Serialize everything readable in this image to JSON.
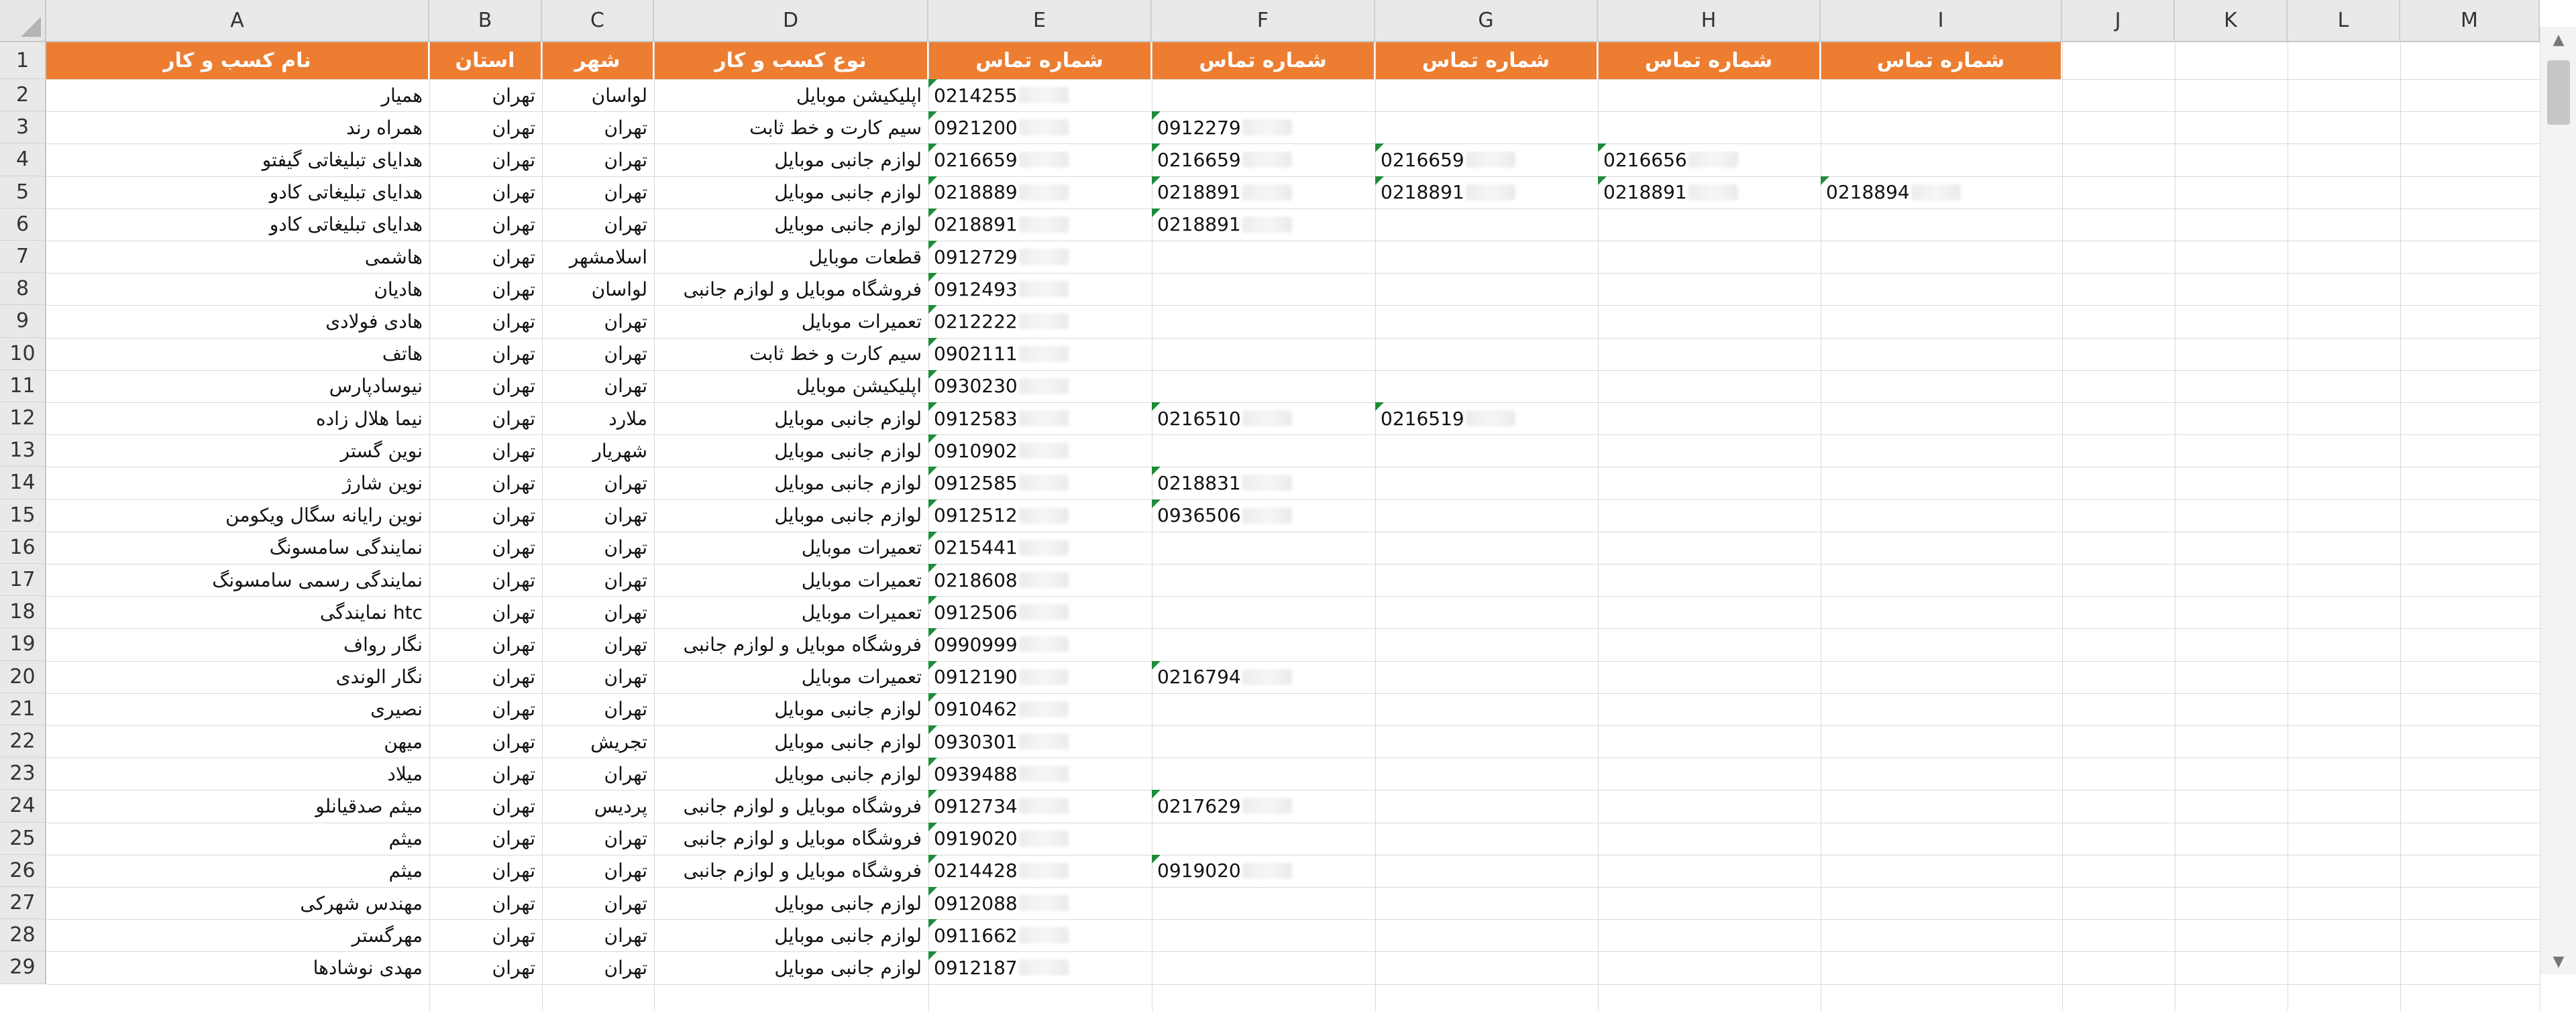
{
  "columns": [
    "A",
    "B",
    "C",
    "D",
    "E",
    "F",
    "G",
    "H",
    "I",
    "J",
    "K",
    "L",
    "M"
  ],
  "header_color": "#ed7d31",
  "flag_color": "#1e8c3a",
  "headers": [
    "نام کسب و کار",
    "استان",
    "شهر",
    "نوع کسب و کار",
    "شماره تماس",
    "شماره تماس",
    "شماره تماس",
    "شماره تماس",
    "شماره تماس"
  ],
  "rows": [
    {
      "num": "2",
      "name": "همیار",
      "province": "تهران",
      "city": "لواسان",
      "type": "اپلیکیشن موبایل",
      "phones": [
        "0214255",
        "",
        "",
        "",
        ""
      ]
    },
    {
      "num": "3",
      "name": "همراه رند",
      "province": "تهران",
      "city": "تهران",
      "type": "سیم کارت و خط ثابت",
      "phones": [
        "0921200",
        "0912279",
        "",
        "",
        ""
      ]
    },
    {
      "num": "4",
      "name": "هدایای تبلیغاتی گیفتو",
      "province": "تهران",
      "city": "تهران",
      "type": "لوازم جانبی موبایل",
      "phones": [
        "0216659",
        "0216659",
        "0216659",
        "0216656",
        ""
      ]
    },
    {
      "num": "5",
      "name": "هدایای تبلیغاتی کادو",
      "province": "تهران",
      "city": "تهران",
      "type": "لوازم جانبی موبایل",
      "phones": [
        "0218889",
        "0218891",
        "0218891",
        "0218891",
        "0218894"
      ]
    },
    {
      "num": "6",
      "name": "هدایای تبلیغاتی کادو",
      "province": "تهران",
      "city": "تهران",
      "type": "لوازم جانبی موبایل",
      "phones": [
        "0218891",
        "0218891",
        "",
        "",
        ""
      ]
    },
    {
      "num": "7",
      "name": "هاشمی",
      "province": "تهران",
      "city": "اسلامشهر",
      "type": "قطعات موبایل",
      "phones": [
        "0912729",
        "",
        "",
        "",
        ""
      ]
    },
    {
      "num": "8",
      "name": "هادیان",
      "province": "تهران",
      "city": "لواسان",
      "type": "فروشگاه موبایل و لوازم جانبی",
      "phones": [
        "0912493",
        "",
        "",
        "",
        ""
      ]
    },
    {
      "num": "9",
      "name": "هادی فولادی",
      "province": "تهران",
      "city": "تهران",
      "type": "تعمیرات موبایل",
      "phones": [
        "0212222",
        "",
        "",
        "",
        ""
      ]
    },
    {
      "num": "10",
      "name": "هاتف",
      "province": "تهران",
      "city": "تهران",
      "type": "سیم کارت و خط ثابت",
      "phones": [
        "0902111",
        "",
        "",
        "",
        ""
      ]
    },
    {
      "num": "11",
      "name": "نیوسادپارس",
      "province": "تهران",
      "city": "تهران",
      "type": "اپلیکیشن موبایل",
      "phones": [
        "0930230",
        "",
        "",
        "",
        ""
      ]
    },
    {
      "num": "12",
      "name": "نیما هلال زاده",
      "province": "تهران",
      "city": "ملارد",
      "type": "لوازم جانبی موبایل",
      "phones": [
        "0912583",
        "0216510",
        "0216519",
        "",
        ""
      ]
    },
    {
      "num": "13",
      "name": "نوین گستر",
      "province": "تهران",
      "city": "شهریار",
      "type": "لوازم جانبی موبایل",
      "phones": [
        "0910902",
        "",
        "",
        "",
        ""
      ]
    },
    {
      "num": "14",
      "name": "نوین شارژ",
      "province": "تهران",
      "city": "تهران",
      "type": "لوازم جانبی موبایل",
      "phones": [
        "0912585",
        "0218831",
        "",
        "",
        ""
      ]
    },
    {
      "num": "15",
      "name": "نوین رایانه سگال ویکومن",
      "province": "تهران",
      "city": "تهران",
      "type": "لوازم جانبی موبایل",
      "phones": [
        "0912512",
        "0936506",
        "",
        "",
        ""
      ]
    },
    {
      "num": "16",
      "name": "نمایندگی سامسونگ",
      "province": "تهران",
      "city": "تهران",
      "type": "تعمیرات موبایل",
      "phones": [
        "0215441",
        "",
        "",
        "",
        ""
      ]
    },
    {
      "num": "17",
      "name": "نمایندگی رسمی سامسونگ",
      "province": "تهران",
      "city": "تهران",
      "type": "تعمیرات موبایل",
      "phones": [
        "0218608",
        "",
        "",
        "",
        ""
      ]
    },
    {
      "num": "18",
      "name": "نمایندگی htc",
      "province": "تهران",
      "city": "تهران",
      "type": "تعمیرات موبایل",
      "phones": [
        "0912506",
        "",
        "",
        "",
        ""
      ]
    },
    {
      "num": "19",
      "name": "نگار رواف",
      "province": "تهران",
      "city": "تهران",
      "type": "فروشگاه موبایل و لوازم جانبی",
      "phones": [
        "0990999",
        "",
        "",
        "",
        ""
      ]
    },
    {
      "num": "20",
      "name": "نگار الوندی",
      "province": "تهران",
      "city": "تهران",
      "type": "تعمیرات موبایل",
      "phones": [
        "0912190",
        "0216794",
        "",
        "",
        ""
      ]
    },
    {
      "num": "21",
      "name": "نصیری",
      "province": "تهران",
      "city": "تهران",
      "type": "لوازم جانبی موبایل",
      "phones": [
        "0910462",
        "",
        "",
        "",
        ""
      ]
    },
    {
      "num": "22",
      "name": "میهن",
      "province": "تهران",
      "city": "تجریش",
      "type": "لوازم جانبی موبایل",
      "phones": [
        "0930301",
        "",
        "",
        "",
        ""
      ]
    },
    {
      "num": "23",
      "name": "میلاد",
      "province": "تهران",
      "city": "تهران",
      "type": "لوازم جانبی موبایل",
      "phones": [
        "0939488",
        "",
        "",
        "",
        ""
      ]
    },
    {
      "num": "24",
      "name": "میثم صدقیانلو",
      "province": "تهران",
      "city": "پردیس",
      "type": "فروشگاه موبایل و لوازم جانبی",
      "phones": [
        "0912734",
        "0217629",
        "",
        "",
        ""
      ]
    },
    {
      "num": "25",
      "name": "میثم",
      "province": "تهران",
      "city": "تهران",
      "type": "فروشگاه موبایل و لوازم جانبی",
      "phones": [
        "0919020",
        "",
        "",
        "",
        ""
      ]
    },
    {
      "num": "26",
      "name": "میثم",
      "province": "تهران",
      "city": "تهران",
      "type": "فروشگاه موبایل و لوازم جانبی",
      "phones": [
        "0214428",
        "0919020",
        "",
        "",
        ""
      ]
    },
    {
      "num": "27",
      "name": "مهندس شهرکی",
      "province": "تهران",
      "city": "تهران",
      "type": "لوازم جانبی موبایل",
      "phones": [
        "0912088",
        "",
        "",
        "",
        ""
      ]
    },
    {
      "num": "28",
      "name": "مهرگستر",
      "province": "تهران",
      "city": "تهران",
      "type": "لوازم جانبی موبایل",
      "phones": [
        "0911662",
        "",
        "",
        "",
        ""
      ]
    },
    {
      "num": "29",
      "name": "مهدی نوشادها",
      "province": "تهران",
      "city": "تهران",
      "type": "لوازم جانبی موبایل",
      "phones": [
        "0912187",
        "",
        "",
        "",
        ""
      ]
    }
  ]
}
